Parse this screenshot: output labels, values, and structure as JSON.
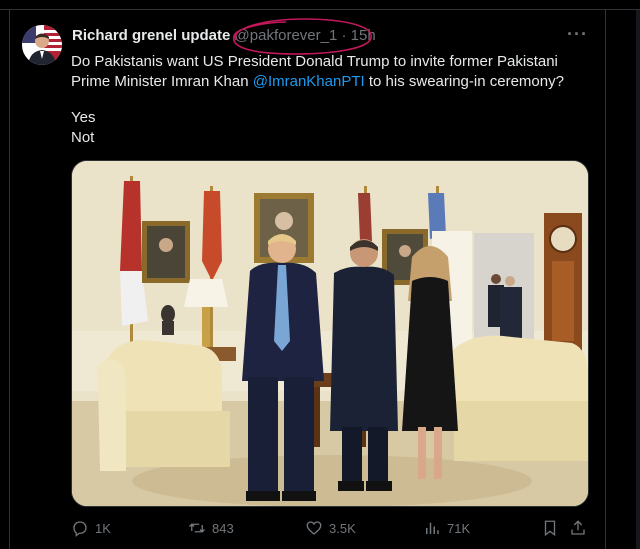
{
  "tweet": {
    "author_name": "Richard grenel update",
    "handle": "@pakforever_1",
    "separator": "·",
    "time_ago": "15h",
    "text_part1": "Do Pakistanis want US President Donald Trump to invite former Pakistani Prime Minister Imran Khan ",
    "mention": "@ImranKhanPTI",
    "text_part2": " to his swearing-in ceremony?",
    "poll_option_1": "Yes",
    "poll_option_2": "Not",
    "more_label": "···"
  },
  "metrics": {
    "replies": "1K",
    "reposts": "843",
    "likes": "3.5K",
    "views": "71K"
  },
  "colors": {
    "background": "#000000",
    "text_primary": "#e7e9ea",
    "text_secondary": "#71767b",
    "link": "#1d9bf0",
    "annotation_circle": "#c2185b"
  },
  "icons": {
    "reply": "reply-icon",
    "repost": "repost-icon",
    "like": "like-icon",
    "views": "views-icon",
    "bookmark": "bookmark-icon",
    "share": "share-icon",
    "more": "more-icon"
  }
}
